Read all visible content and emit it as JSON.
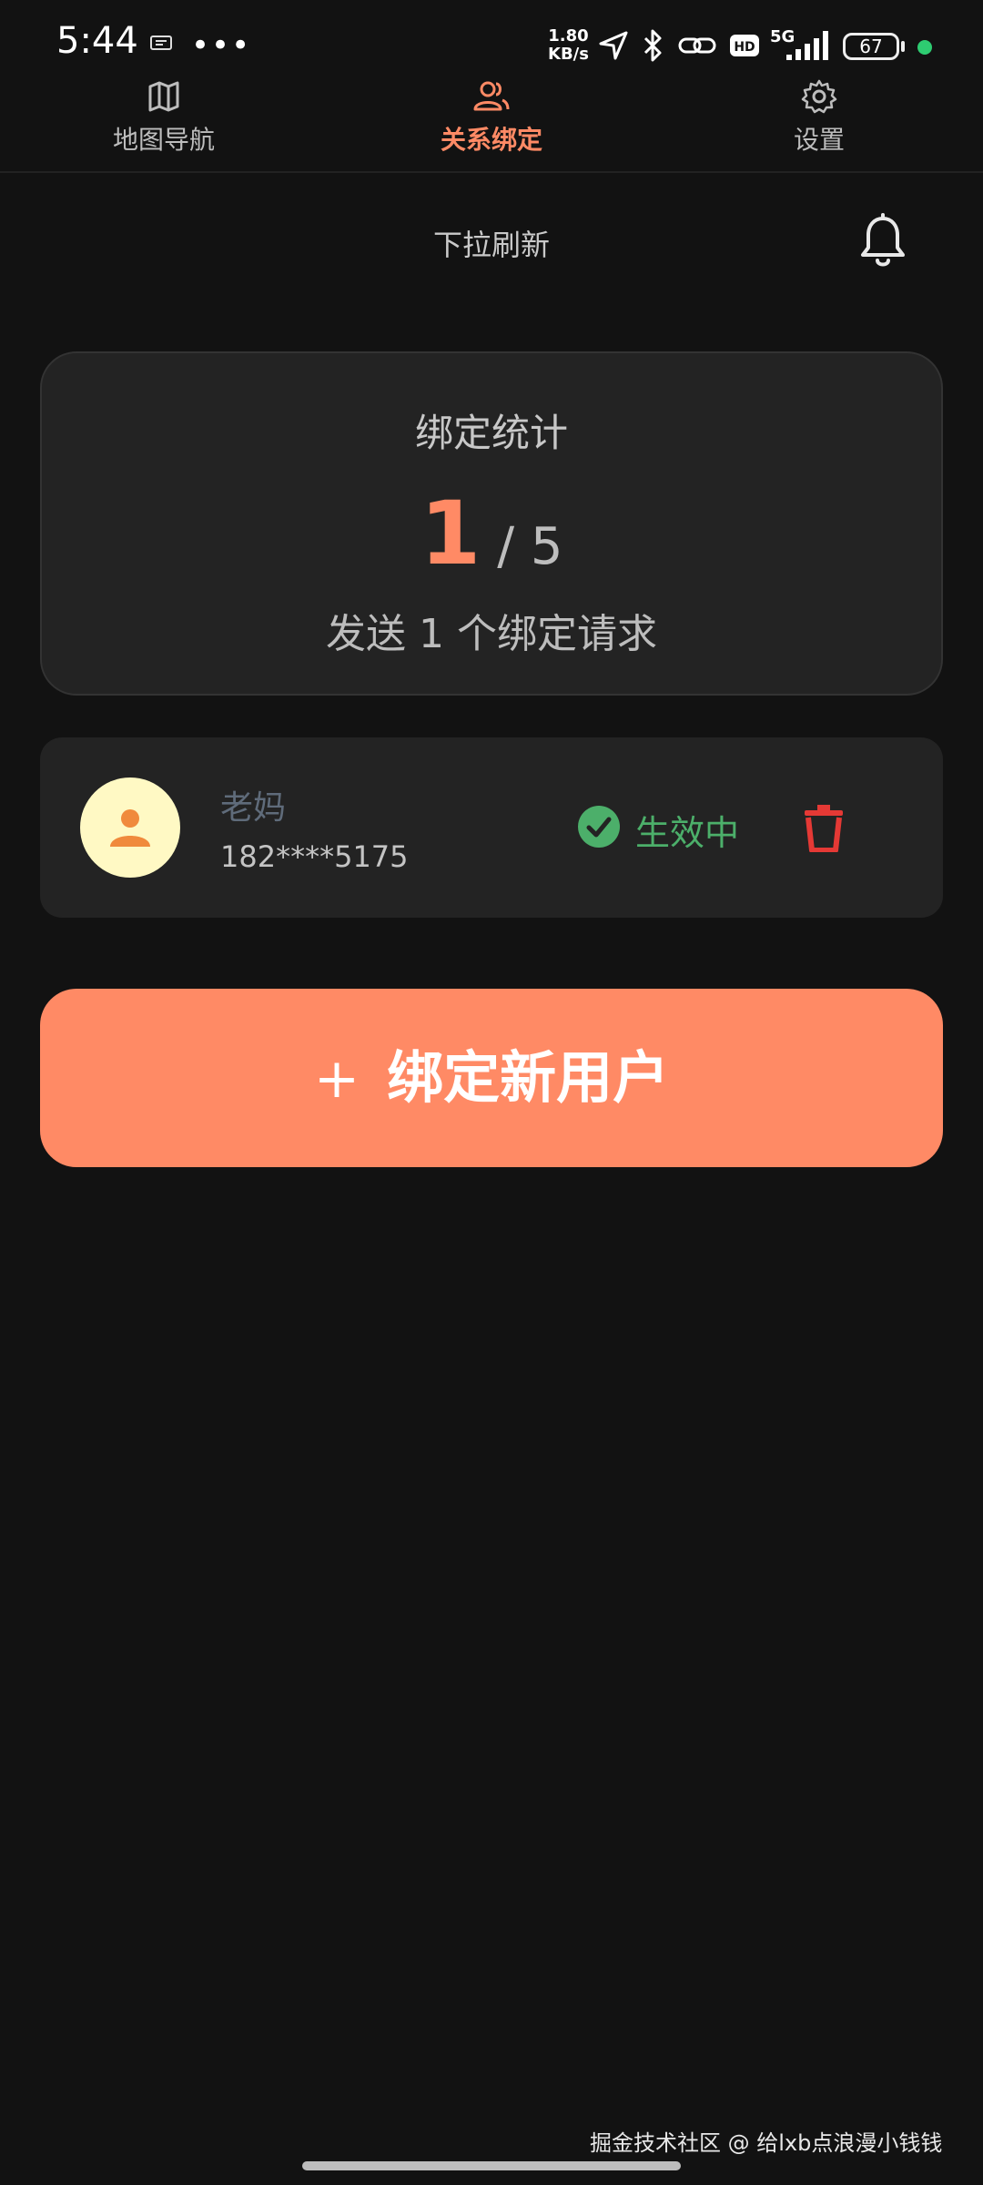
{
  "status_bar": {
    "time": "5:44",
    "speed_top": "1.80",
    "speed_bottom": "KB/s",
    "network": "5G",
    "battery": "67"
  },
  "nav": {
    "items": [
      {
        "label": "地图导航",
        "icon": "map-icon"
      },
      {
        "label": "关系绑定",
        "icon": "users-icon",
        "active": true
      },
      {
        "label": "设置",
        "icon": "gear-icon"
      }
    ]
  },
  "header": {
    "pull_refresh": "下拉刷新"
  },
  "stats": {
    "title": "绑定统计",
    "count": "1",
    "separator_total": "/ 5",
    "description": "发送 1 个绑定请求"
  },
  "binding": {
    "name": "老妈",
    "phone": "182****5175",
    "status": "生效中"
  },
  "bind_button": {
    "plus": "+",
    "label": "绑定新用户"
  },
  "watermark": "掘金技术社区 @ 给lxb点浪漫小钱钱",
  "colors": {
    "accent": "#ff8a65",
    "active_green": "#4caf6a",
    "delete_red": "#e53935",
    "background": "#121212"
  }
}
